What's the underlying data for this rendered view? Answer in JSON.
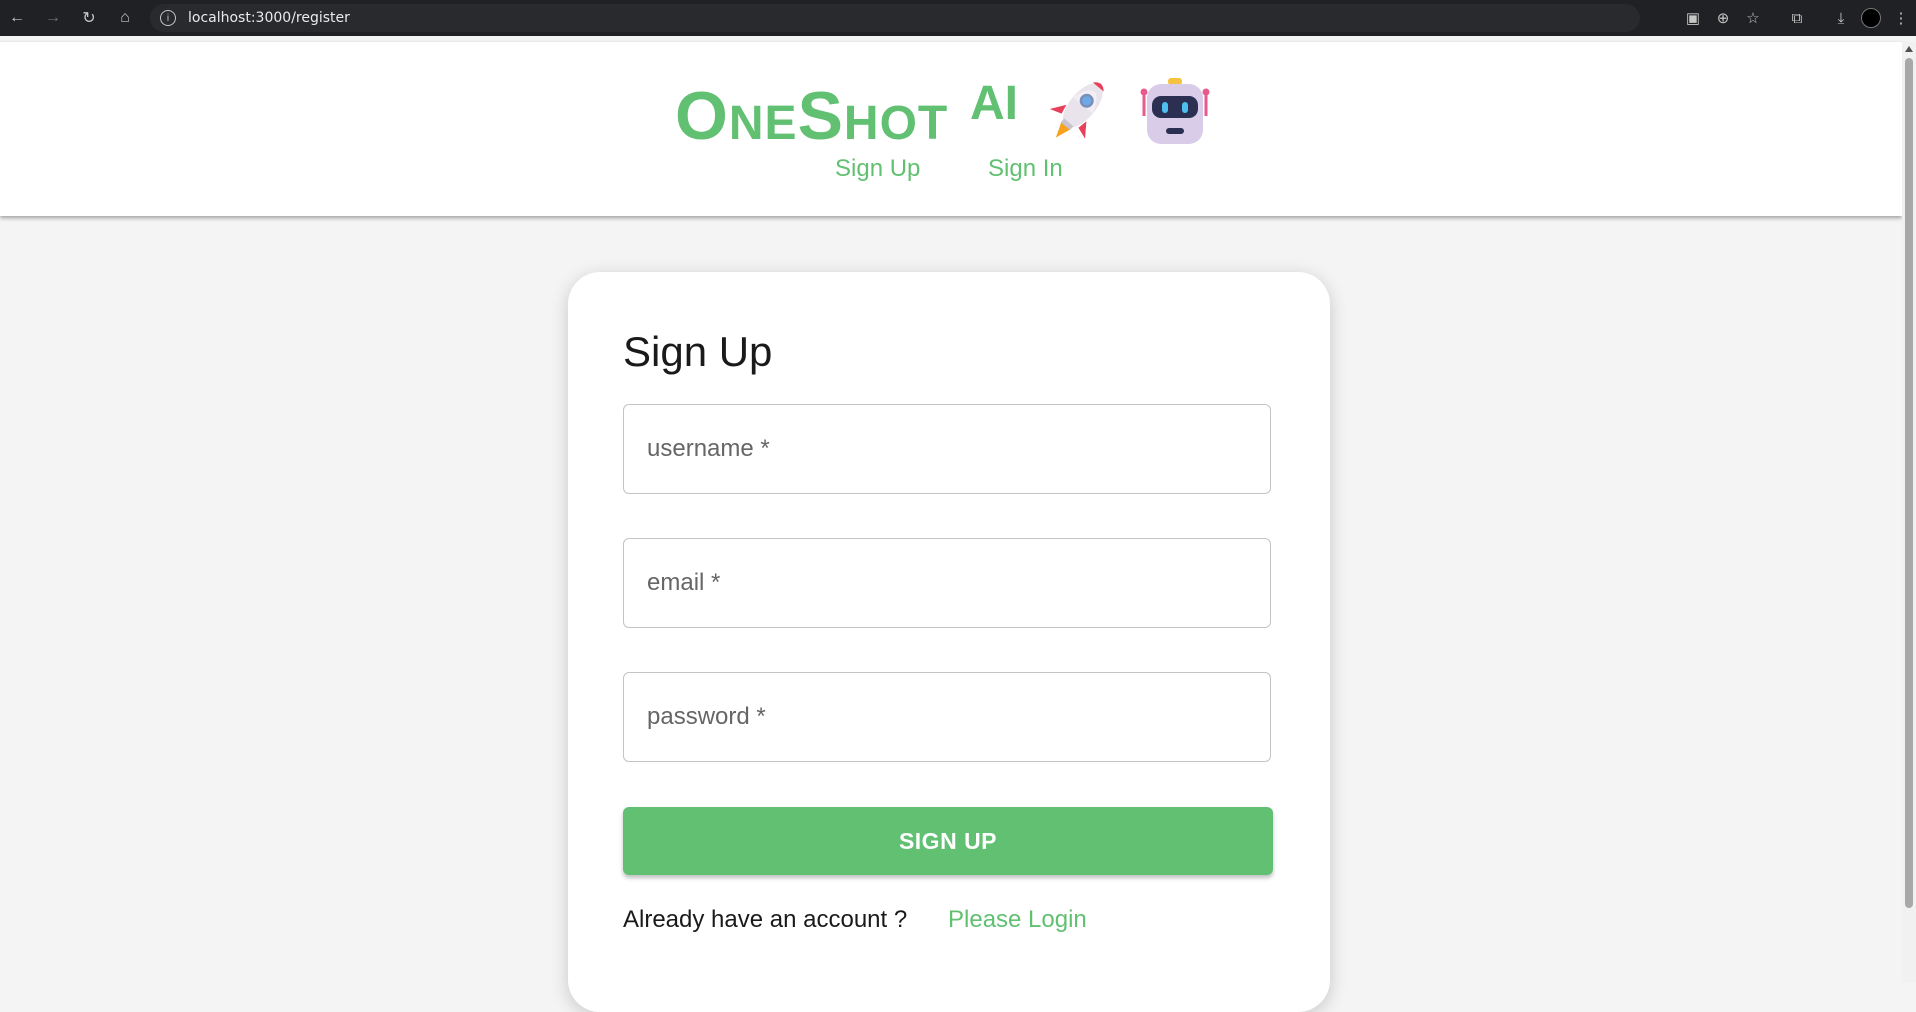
{
  "browser": {
    "url": "localhost:3000/register"
  },
  "header": {
    "brand": "OneShot",
    "brand_suffix": "AI",
    "nav": [
      {
        "label": "Sign Up"
      },
      {
        "label": "Sign In"
      }
    ]
  },
  "form": {
    "title": "Sign Up",
    "fields": [
      {
        "placeholder": "username *"
      },
      {
        "placeholder": "email *"
      },
      {
        "placeholder": "password *"
      }
    ],
    "submit_label": "SIGN UP",
    "footer_text": "Already have an account ?",
    "login_link": "Please Login"
  },
  "colors": {
    "accent": "#61c072",
    "browser_bar": "#202124"
  }
}
